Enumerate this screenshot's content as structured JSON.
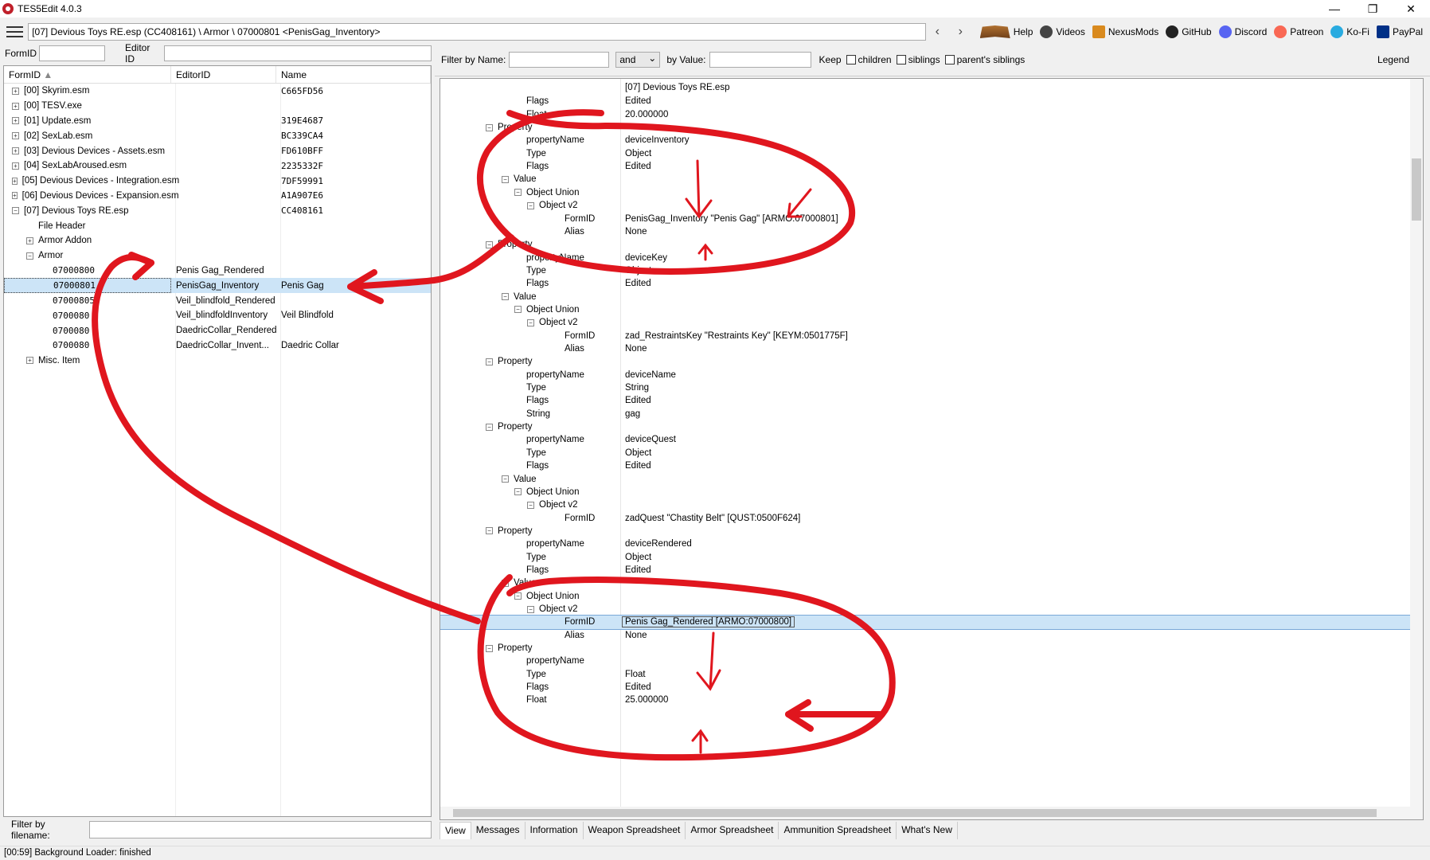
{
  "window": {
    "title": "TES5Edit 4.0.3",
    "min": "—",
    "max": "❐",
    "close": "✕"
  },
  "nav": {
    "path": "[07] Devious Toys RE.esp (CC408161) \\ Armor \\ 07000801 <PenisGag_Inventory>",
    "back": "‹",
    "forward": "›",
    "links": [
      "Help",
      "Videos",
      "NexusMods",
      "GitHub",
      "Discord",
      "Patreon",
      "Ko-Fi",
      "PayPal"
    ]
  },
  "left": {
    "formid_label": "FormID",
    "editorid_label": "Editor ID",
    "columns": [
      "FormID",
      "EditorID",
      "Name"
    ],
    "rows": [
      {
        "indent": 0,
        "exp": "+",
        "formid": "[00] Skyrim.esm",
        "editorid": "",
        "name": "C665FD56"
      },
      {
        "indent": 0,
        "exp": "+",
        "formid": "[00] TESV.exe",
        "editorid": "",
        "name": ""
      },
      {
        "indent": 0,
        "exp": "+",
        "formid": "[01] Update.esm",
        "editorid": "",
        "name": "319E4687"
      },
      {
        "indent": 0,
        "exp": "+",
        "formid": "[02] SexLab.esm",
        "editorid": "",
        "name": "BC339CA4"
      },
      {
        "indent": 0,
        "exp": "+",
        "formid": "[03] Devious Devices - Assets.esm",
        "editorid": "",
        "name": "FD610BFF"
      },
      {
        "indent": 0,
        "exp": "+",
        "formid": "[04] SexLabAroused.esm",
        "editorid": "",
        "name": "2235332F"
      },
      {
        "indent": 0,
        "exp": "+",
        "formid": "[05] Devious Devices - Integration.esm",
        "editorid": "",
        "name": "7DF59991"
      },
      {
        "indent": 0,
        "exp": "+",
        "formid": "[06] Devious Devices - Expansion.esm",
        "editorid": "",
        "name": "A1A907E6"
      },
      {
        "indent": 0,
        "exp": "−",
        "formid": "[07] Devious Toys RE.esp",
        "editorid": "",
        "name": "CC408161"
      },
      {
        "indent": 1,
        "exp": "",
        "formid": "File Header",
        "editorid": "",
        "name": ""
      },
      {
        "indent": 1,
        "exp": "+",
        "formid": "Armor Addon",
        "editorid": "",
        "name": ""
      },
      {
        "indent": 1,
        "exp": "−",
        "formid": "Armor",
        "editorid": "",
        "name": ""
      },
      {
        "indent": 2,
        "exp": "",
        "formid": "07000800",
        "editorid": "Penis Gag_Rendered",
        "name": ""
      },
      {
        "indent": 2,
        "exp": "",
        "formid": "07000801",
        "editorid": "PenisGag_Inventory",
        "name": "Penis Gag",
        "sel": true
      },
      {
        "indent": 2,
        "exp": "",
        "formid": "07000805",
        "editorid": "Veil_blindfold_Rendered",
        "name": ""
      },
      {
        "indent": 2,
        "exp": "",
        "formid": "0700080",
        "editorid": "Veil_blindfoldInventory",
        "name": "Veil Blindfold"
      },
      {
        "indent": 2,
        "exp": "",
        "formid": "0700080",
        "editorid": "DaedricCollar_Rendered",
        "name": ""
      },
      {
        "indent": 2,
        "exp": "",
        "formid": "0700080",
        "editorid": "DaedricCollar_Invent...",
        "name": "Daedric Collar"
      },
      {
        "indent": 1,
        "exp": "+",
        "formid": "Misc. Item",
        "editorid": "",
        "name": ""
      }
    ],
    "filename_label": "Filter by filename:"
  },
  "right": {
    "filter_name_label": "Filter by Name:",
    "and_option": "and",
    "by_value_label": "by Value:",
    "keep_label": "Keep",
    "children_label": "children",
    "siblings_label": "siblings",
    "parents_siblings_label": "parent's siblings",
    "legend_label": "Legend",
    "header_value": "[07] Devious Toys RE.esp",
    "rows": [
      {
        "lvl": 3,
        "exp": "",
        "label": "Flags",
        "value": "Edited"
      },
      {
        "lvl": 3,
        "exp": "",
        "label": "Float",
        "value": "20.000000"
      },
      {
        "lvl": 2,
        "exp": "−",
        "label": "Property",
        "value": ""
      },
      {
        "lvl": 3,
        "exp": "",
        "label": "propertyName",
        "value": "deviceInventory"
      },
      {
        "lvl": 3,
        "exp": "",
        "label": "Type",
        "value": "Object"
      },
      {
        "lvl": 3,
        "exp": "",
        "label": "Flags",
        "value": "Edited"
      },
      {
        "lvl": 3,
        "exp": "−",
        "label": "Value",
        "value": ""
      },
      {
        "lvl": 4,
        "exp": "−",
        "label": "Object Union",
        "value": ""
      },
      {
        "lvl": 5,
        "exp": "−",
        "label": "Object v2",
        "value": ""
      },
      {
        "lvl": 6,
        "exp": "",
        "label": "FormID",
        "value": "PenisGag_Inventory \"Penis Gag\" [ARMO:07000801]"
      },
      {
        "lvl": 6,
        "exp": "",
        "label": "Alias",
        "value": "None"
      },
      {
        "lvl": 2,
        "exp": "−",
        "label": "Property",
        "value": ""
      },
      {
        "lvl": 3,
        "exp": "",
        "label": "propertyName",
        "value": "deviceKey"
      },
      {
        "lvl": 3,
        "exp": "",
        "label": "Type",
        "value": "Object"
      },
      {
        "lvl": 3,
        "exp": "",
        "label": "Flags",
        "value": "Edited"
      },
      {
        "lvl": 3,
        "exp": "−",
        "label": "Value",
        "value": ""
      },
      {
        "lvl": 4,
        "exp": "−",
        "label": "Object Union",
        "value": ""
      },
      {
        "lvl": 5,
        "exp": "−",
        "label": "Object v2",
        "value": ""
      },
      {
        "lvl": 6,
        "exp": "",
        "label": "FormID",
        "value": "zad_RestraintsKey \"Restraints Key\" [KEYM:0501775F]"
      },
      {
        "lvl": 6,
        "exp": "",
        "label": "Alias",
        "value": "None"
      },
      {
        "lvl": 2,
        "exp": "−",
        "label": "Property",
        "value": ""
      },
      {
        "lvl": 3,
        "exp": "",
        "label": "propertyName",
        "value": "deviceName"
      },
      {
        "lvl": 3,
        "exp": "",
        "label": "Type",
        "value": "String"
      },
      {
        "lvl": 3,
        "exp": "",
        "label": "Flags",
        "value": "Edited"
      },
      {
        "lvl": 3,
        "exp": "",
        "label": "String",
        "value": "gag"
      },
      {
        "lvl": 2,
        "exp": "−",
        "label": "Property",
        "value": ""
      },
      {
        "lvl": 3,
        "exp": "",
        "label": "propertyName",
        "value": "deviceQuest"
      },
      {
        "lvl": 3,
        "exp": "",
        "label": "Type",
        "value": "Object"
      },
      {
        "lvl": 3,
        "exp": "",
        "label": "Flags",
        "value": "Edited"
      },
      {
        "lvl": 3,
        "exp": "−",
        "label": "Value",
        "value": ""
      },
      {
        "lvl": 4,
        "exp": "−",
        "label": "Object Union",
        "value": ""
      },
      {
        "lvl": 5,
        "exp": "−",
        "label": "Object v2",
        "value": ""
      },
      {
        "lvl": 6,
        "exp": "",
        "label": "FormID",
        "value": "zadQuest \"Chastity Belt\" [QUST:0500F624]"
      },
      {
        "lvl": 2,
        "exp": "−",
        "label": "Property",
        "value": ""
      },
      {
        "lvl": 3,
        "exp": "",
        "label": "propertyName",
        "value": "deviceRendered"
      },
      {
        "lvl": 3,
        "exp": "",
        "label": "Type",
        "value": "Object"
      },
      {
        "lvl": 3,
        "exp": "",
        "label": "Flags",
        "value": "Edited"
      },
      {
        "lvl": 3,
        "exp": "−",
        "label": "Value",
        "value": ""
      },
      {
        "lvl": 4,
        "exp": "−",
        "label": "Object Union",
        "value": ""
      },
      {
        "lvl": 5,
        "exp": "−",
        "label": "Object v2",
        "value": ""
      },
      {
        "lvl": 6,
        "exp": "",
        "label": "FormID",
        "value": "Penis Gag_Rendered [ARMO:07000800]",
        "hl": true
      },
      {
        "lvl": 6,
        "exp": "",
        "label": "Alias",
        "value": "None"
      },
      {
        "lvl": 2,
        "exp": "−",
        "label": "Property",
        "value": ""
      },
      {
        "lvl": 3,
        "exp": "",
        "label": "propertyName",
        "value": ""
      },
      {
        "lvl": 3,
        "exp": "",
        "label": "Type",
        "value": "Float"
      },
      {
        "lvl": 3,
        "exp": "",
        "label": "Flags",
        "value": "Edited"
      },
      {
        "lvl": 3,
        "exp": "",
        "label": "Float",
        "value": "25.000000"
      }
    ],
    "tabs": [
      "View",
      "Messages",
      "Information",
      "Weapon Spreadsheet",
      "Armor Spreadsheet",
      "Ammunition Spreadsheet",
      "What's New"
    ]
  },
  "status": "[00:59] Background Loader: finished",
  "colors": {
    "selection": "#cce4f7",
    "annotation": "#e0161e"
  }
}
